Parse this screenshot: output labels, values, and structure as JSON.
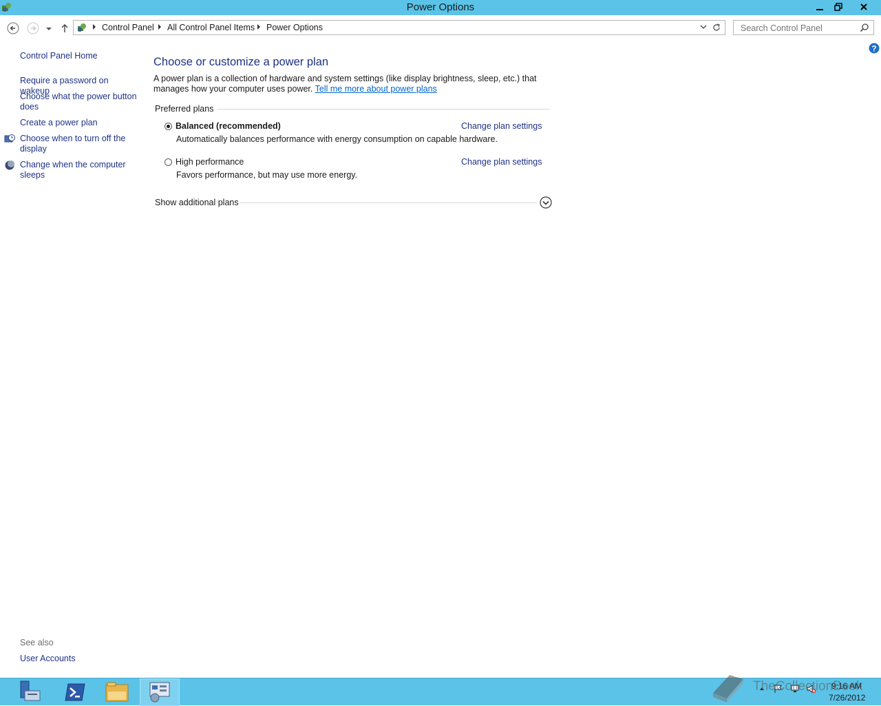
{
  "window": {
    "title": "Power Options",
    "controls": {
      "minimize": "—",
      "restore": "❐",
      "close": "✕"
    }
  },
  "nav": {
    "breadcrumbs": [
      "Control Panel",
      "All Control Panel Items",
      "Power Options"
    ],
    "search_placeholder": "Search Control Panel"
  },
  "sidebar": {
    "home": "Control Panel Home",
    "items": [
      {
        "label": "Require a password on wakeup",
        "icon": "none"
      },
      {
        "label": "Choose what the power button does",
        "icon": "none"
      },
      {
        "label": "Create a power plan",
        "icon": "none"
      },
      {
        "label": "Choose when to turn off the display",
        "icon": "display-timer-icon"
      },
      {
        "label": "Change when the computer sleeps",
        "icon": "moon-sleep-icon"
      }
    ],
    "see_also_label": "See also",
    "see_also_links": [
      "User Accounts"
    ]
  },
  "main": {
    "title": "Choose or customize a power plan",
    "description": "A power plan is a collection of hardware and system settings (like display brightness, sleep, etc.) that manages how your computer uses power.",
    "learn_more_link": "Tell me more about power plans",
    "preferred_label": "Preferred plans",
    "plans": [
      {
        "name": "Balanced (recommended)",
        "selected": true,
        "description": "Automatically balances performance with energy consumption on capable hardware.",
        "link": "Change plan settings"
      },
      {
        "name": "High performance",
        "selected": false,
        "description": "Favors performance, but may use more energy.",
        "link": "Change plan settings"
      }
    ],
    "additional_label": "Show additional plans"
  },
  "taskbar": {
    "apps": [
      "server-manager-icon",
      "powershell-icon",
      "file-explorer-icon",
      "control-panel-icon"
    ],
    "active_app": "control-panel-icon",
    "time": "9:16 AM",
    "date": "7/26/2012",
    "watermark": "TheCollectionBook"
  },
  "colors": {
    "chrome": "#5bc3e8",
    "link": "#1e3287",
    "hyperlink": "#0066cc"
  }
}
